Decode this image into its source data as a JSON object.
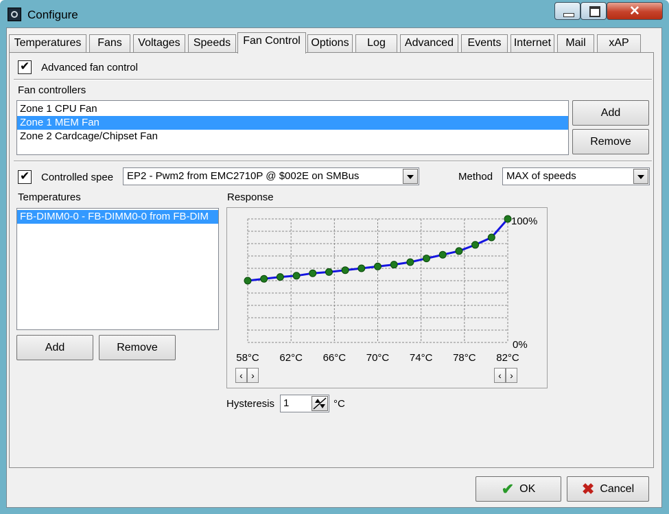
{
  "window": {
    "title": "Configure"
  },
  "tabs": [
    {
      "label": "Temperatures"
    },
    {
      "label": "Fans"
    },
    {
      "label": "Voltages"
    },
    {
      "label": "Speeds"
    },
    {
      "label": "Fan Control",
      "active": true
    },
    {
      "label": "Options"
    },
    {
      "label": "Log"
    },
    {
      "label": "Advanced"
    },
    {
      "label": "Events"
    },
    {
      "label": "Internet"
    },
    {
      "label": "Mail"
    },
    {
      "label": "xAP"
    }
  ],
  "advanced": {
    "label": "Advanced fan control",
    "checked": true
  },
  "fan_controllers": {
    "label": "Fan controllers",
    "items": [
      {
        "label": "Zone 1 CPU Fan"
      },
      {
        "label": "Zone 1 MEM Fan",
        "selected": true
      },
      {
        "label": "Zone 2 Cardcage/Chipset Fan"
      }
    ],
    "add_label": "Add",
    "remove_label": "Remove"
  },
  "controlled_speed": {
    "label": "Controlled spee",
    "checked": true,
    "value": "EP2 - Pwm2 from EMC2710P @ $002E on SMBus"
  },
  "method": {
    "label": "Method",
    "value": "MAX of speeds"
  },
  "temperatures": {
    "label": "Temperatures",
    "items": [
      {
        "label": "FB-DIMM0-0 - FB-DIMM0-0 from FB-DIM",
        "selected": true
      }
    ],
    "add_label": "Add",
    "remove_label": "Remove"
  },
  "response": {
    "label": "Response",
    "y_max_label": "100%",
    "y_min_label": "0%",
    "x_ticks": [
      "58°C",
      "62°C",
      "66°C",
      "70°C",
      "74°C",
      "78°C",
      "82°C"
    ]
  },
  "chart_data": {
    "type": "line",
    "title": "Response",
    "xlabel": "",
    "ylabel": "",
    "xlim": [
      58,
      82
    ],
    "ylim": [
      0,
      100
    ],
    "x": [
      58,
      59.5,
      61,
      62.5,
      64,
      65.5,
      67,
      68.5,
      70,
      71.5,
      73,
      74.5,
      76,
      77.5,
      79,
      80.5,
      82
    ],
    "series": [
      {
        "values": [
          50,
          51.5,
          53,
          54,
          56,
          57,
          58.5,
          60,
          61.5,
          63,
          65,
          68,
          71,
          74,
          79,
          85,
          100
        ]
      }
    ],
    "grid": true,
    "colors": {
      "line": "#1515e0",
      "point": "#1f7a1f"
    }
  },
  "hysteresis": {
    "label": "Hysteresis",
    "value": "1",
    "unit": "°C"
  },
  "footer": {
    "ok_label": "OK",
    "cancel_label": "Cancel"
  }
}
